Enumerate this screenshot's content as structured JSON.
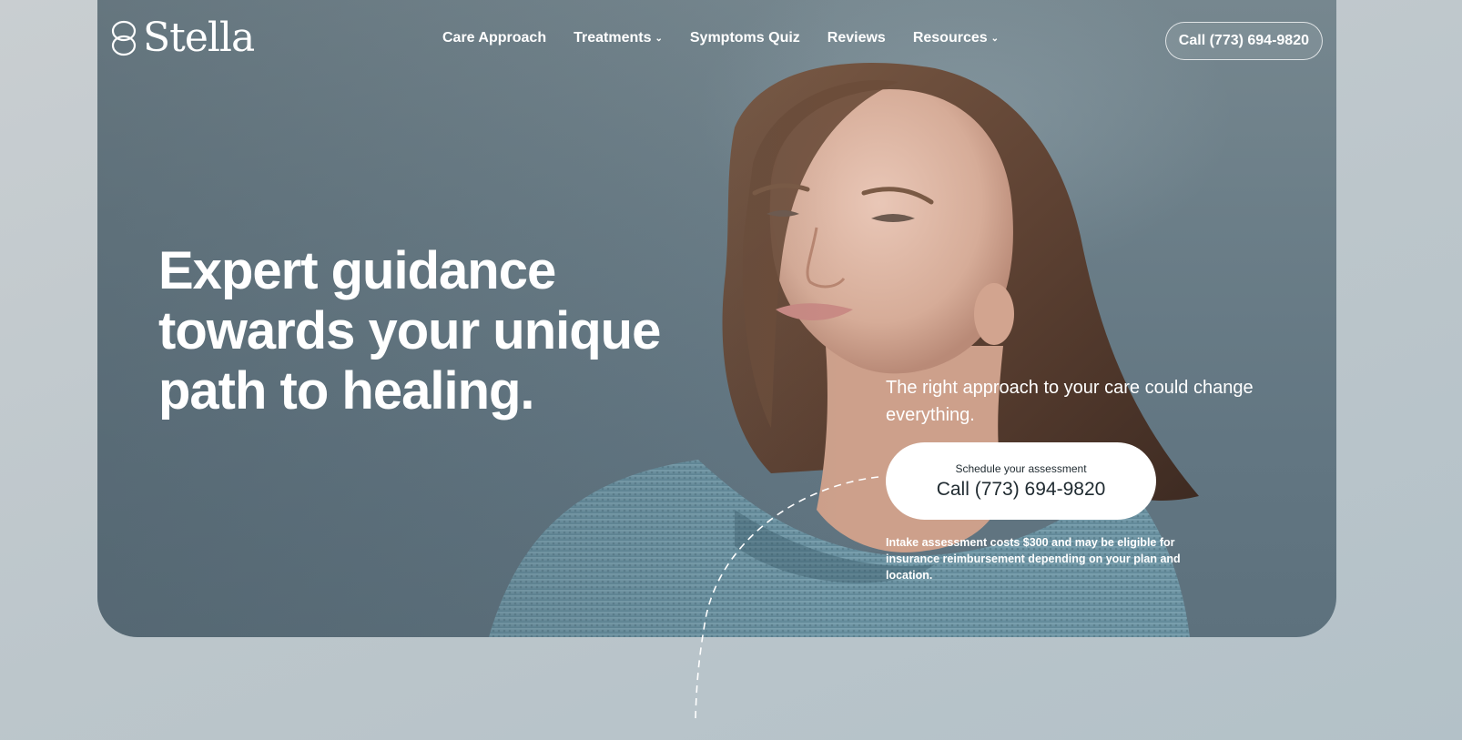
{
  "brand": {
    "name": "Stella",
    "logo_icon": "interlocking-rings-icon"
  },
  "nav": {
    "items": [
      {
        "label": "Care Approach",
        "dropdown": false
      },
      {
        "label": "Treatments",
        "dropdown": true
      },
      {
        "label": "Symptoms Quiz",
        "dropdown": false
      },
      {
        "label": "Reviews",
        "dropdown": false
      },
      {
        "label": "Resources",
        "dropdown": true
      }
    ],
    "call_button": "Call (773) 694-9820",
    "dropdown_icon": "chevron-down-icon"
  },
  "hero": {
    "headline": "Expert guidance towards your unique path to healing.",
    "tagline": "The right approach to your care could change everything.",
    "cta": {
      "small_label": "Schedule your assessment",
      "phone": "Call (773) 694-9820"
    },
    "disclaimer": "Intake assessment costs $300 and may be eligible for insurance reimbursement depending on your plan and location."
  },
  "colors": {
    "hero_bg": "#6b7e88",
    "page_bg": "#bcc6cb",
    "text": "#ffffff",
    "cta_bg": "#ffffff",
    "cta_text": "#1f2a30"
  }
}
